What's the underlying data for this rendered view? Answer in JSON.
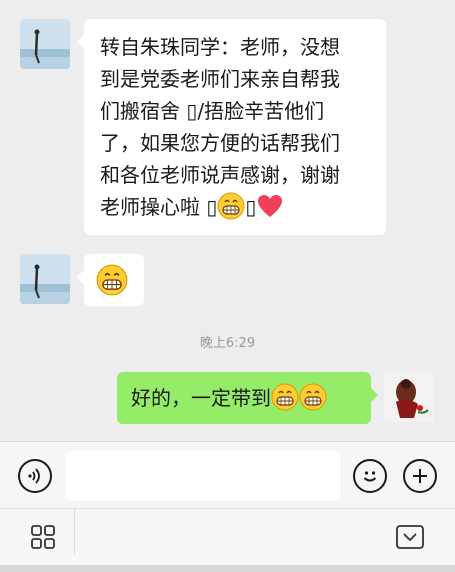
{
  "messages": [
    {
      "side": "incoming",
      "text_lines": [
        "转自朱珠同学：老师，没想",
        "到是党委老师们来亲自帮我",
        "们搬宿舍 ",
        "/捂脸辛苦他们",
        "了，如果您方便的话帮我们",
        "和各位老师说声感谢，谢谢",
        "老师操心啦 "
      ],
      "emoji": [
        "grin-emoji",
        "heart-emoji"
      ]
    },
    {
      "side": "incoming",
      "emoji": [
        "grin-emoji"
      ]
    },
    {
      "side": "outgoing",
      "text": "好的，一定带到",
      "emoji": [
        "grin-emoji",
        "grin-emoji"
      ]
    }
  ],
  "timestamp": "晚上6:29",
  "input": {
    "value": "",
    "placeholder": ""
  },
  "icons": {
    "voice": "voice-icon",
    "emoji": "smiley-icon",
    "plus": "plus-icon",
    "grid": "grid-icon",
    "collapse": "keyboard-collapse-icon"
  },
  "colors": {
    "background": "#ededed",
    "incoming_bubble": "#ffffff",
    "outgoing_bubble": "#95ec69"
  }
}
